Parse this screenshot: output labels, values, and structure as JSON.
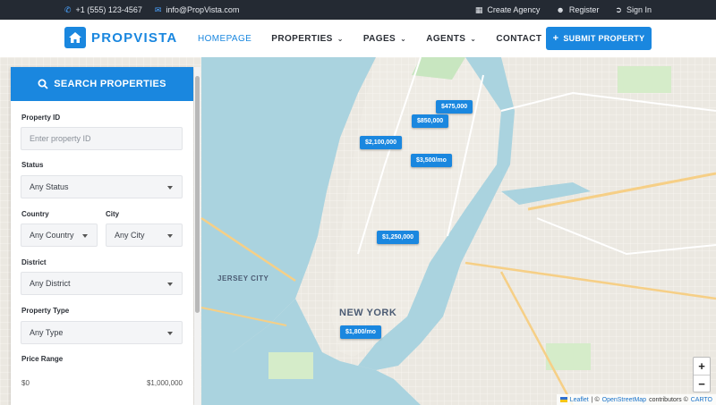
{
  "topbar": {
    "phone": "+1 (555) 123-4567",
    "email": "info@PropVista.com",
    "create_agency": "Create Agency",
    "register": "Register",
    "sign_in": "Sign In"
  },
  "header": {
    "logo_text": "PROPVISTA",
    "nav": {
      "homepage": "HOMEPAGE",
      "properties": "PROPERTIES",
      "pages": "PAGES",
      "agents": "AGENTS",
      "contact": "CONTACT"
    },
    "submit_label": "SUBMIT PROPERTY"
  },
  "search": {
    "title": "SEARCH PROPERTIES",
    "property_id_label": "Property ID",
    "property_id_placeholder": "Enter property ID",
    "status_label": "Status",
    "status_value": "Any Status",
    "country_label": "Country",
    "country_value": "Any Country",
    "city_label": "City",
    "city_value": "Any City",
    "district_label": "District",
    "district_value": "Any District",
    "type_label": "Property Type",
    "type_value": "Any Type",
    "price_label": "Price Range",
    "price_min": "$0",
    "price_max": "$1,000,000"
  },
  "map": {
    "pins": [
      "$475,000",
      "$850,000",
      "$2,100,000",
      "$3,500/mo",
      "$1,250,000",
      "$1,800/mo"
    ],
    "labels": {
      "jersey_city": "JERSEY CITY",
      "new_york": "NEW YORK"
    },
    "attribution": {
      "leaflet": "Leaflet",
      "sep": "| ©",
      "osm": "OpenStreetMap",
      "contrib": "contributors ©",
      "carto": "CARTO"
    }
  },
  "colors": {
    "brand": "#1a87df",
    "topbar": "#242a33",
    "water": "#aad3df"
  }
}
